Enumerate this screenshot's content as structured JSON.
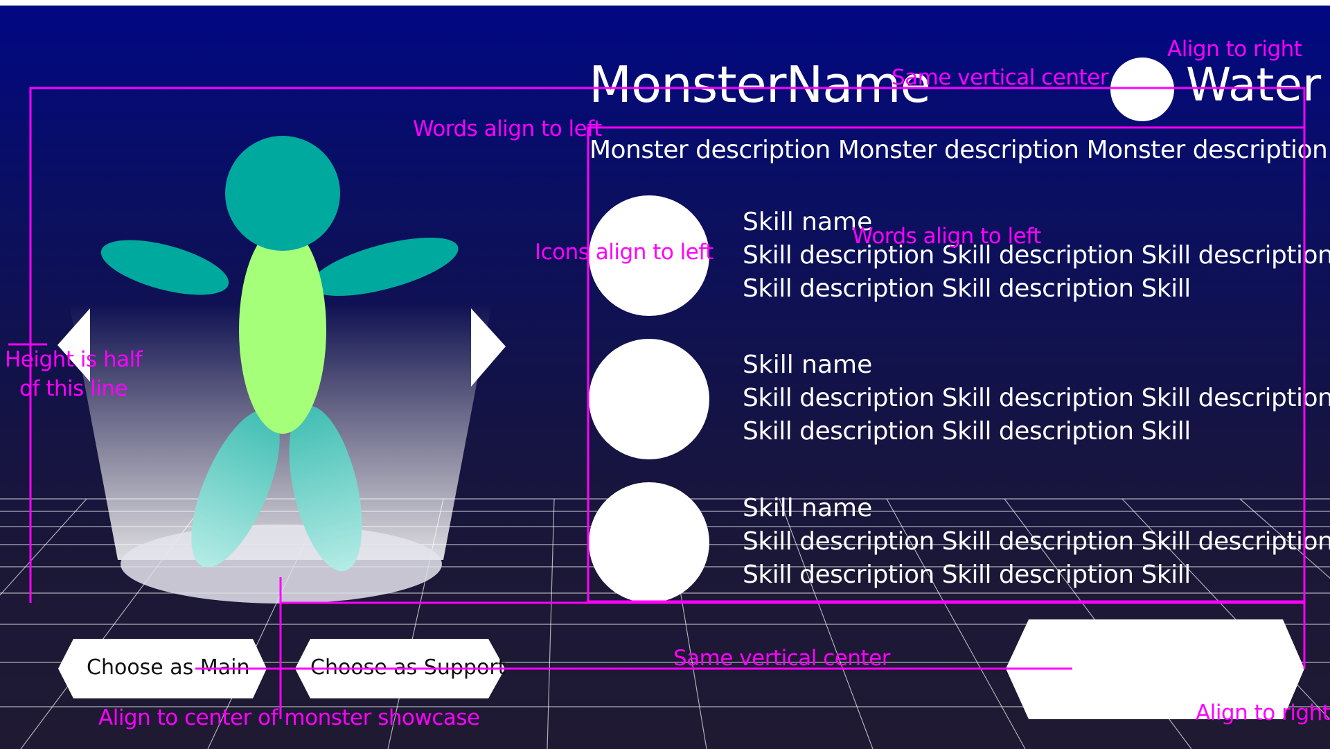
{
  "monster": {
    "name": "MonsterName",
    "type": "Water",
    "description": "Monster description Monster description Monster description"
  },
  "skills": [
    {
      "name": "Skill name",
      "line1": "Skill description Skill description Skill description",
      "line2": "Skill description Skill description Skill"
    },
    {
      "name": "Skill name",
      "line1": "Skill description Skill description Skill description",
      "line2": "Skill description Skill description Skill"
    },
    {
      "name": "Skill name",
      "line1": "Skill description Skill description Skill description",
      "line2": "Skill description Skill description Skill"
    }
  ],
  "buttons": {
    "main": "Choose as Main",
    "support": "Choose as Support",
    "confirm": ""
  },
  "annotations": {
    "align_right_top": "Align to right",
    "same_vcenter_top": "Same vertical center",
    "words_left_1": "Words align to left",
    "icons_left": "Icons align to left",
    "words_left_2": "Words align to left",
    "height_half_1": "Height is half",
    "height_half_2": "of this line",
    "same_vcenter_bottom": "Same vertical center",
    "align_center_showcase": "Align to center of monster showcase",
    "align_right_bottom": "Align to right"
  },
  "colors": {
    "annotation": "#ff00ff",
    "text": "#ffffff",
    "monster_body": "#00a99d",
    "monster_torso": "#a6ff78"
  }
}
